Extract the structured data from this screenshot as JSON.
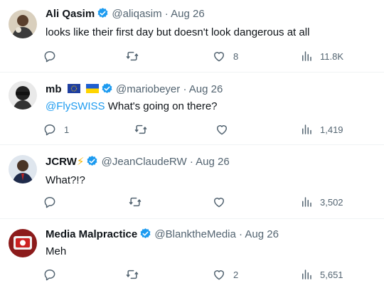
{
  "tweets": [
    {
      "name": "Ali Qasim",
      "handle": "@aliqasim",
      "date": "Aug 26",
      "text": "looks like their first day but doesn't look dangerous at all",
      "replies": "",
      "retweets": "",
      "likes": "8",
      "views": "11.8K"
    },
    {
      "name": "mb",
      "handle": "@mariobeyer",
      "date": "Aug 26",
      "mention": "@FlySWISS",
      "text": " What's going on there?",
      "replies": "1",
      "retweets": "",
      "likes": "",
      "views": "1,419"
    },
    {
      "name": "JCRW",
      "handle": "@JeanClaudeRW",
      "date": "Aug 26",
      "text": "What?!?",
      "replies": "",
      "retweets": "",
      "likes": "",
      "views": "3,502"
    },
    {
      "name": "Media Malpractice",
      "handle": "@BlanktheMedia",
      "date": "Aug 26",
      "text": "Meh",
      "replies": "",
      "retweets": "",
      "likes": "2",
      "views": "5,651"
    }
  ],
  "separator": "·",
  "emoji": "⚡",
  "icons": {
    "verified": "verified-badge-icon",
    "reply": "reply-icon",
    "retweet": "retweet-icon",
    "like": "like-icon",
    "views": "views-icon"
  },
  "colors": {
    "verified": "#1d9bf0",
    "mention": "#1d9bf0",
    "muted": "#536471"
  }
}
